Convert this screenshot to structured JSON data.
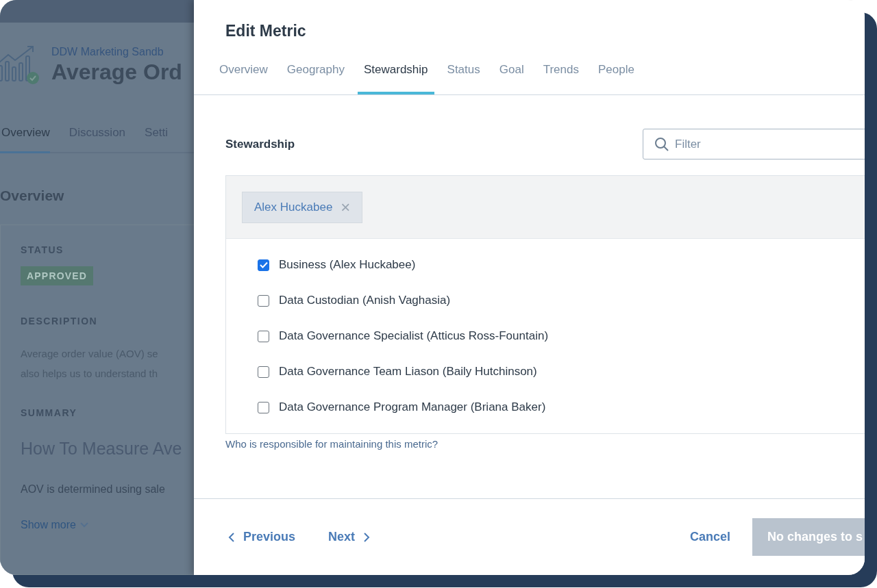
{
  "background_page": {
    "workspace": "DDW Marketing Sandb",
    "title": "Average Ord",
    "tabs": [
      {
        "label": "Overview",
        "selected": true
      },
      {
        "label": "Discussion",
        "selected": false
      },
      {
        "label": "Setti",
        "selected": false
      }
    ],
    "section_title": "Overview",
    "status_label": "STATUS",
    "status_badge": "APPROVED",
    "description_label": "DESCRIPTION",
    "description_lines": [
      "Average order value (AOV) se",
      "also helps us to understand th"
    ],
    "summary_label": "SUMMARY",
    "summary_title": "How To Measure Ave",
    "summary_text": "AOV is determined using sale",
    "show_more": "Show more"
  },
  "dialog": {
    "title": "Edit Metric",
    "tabs": [
      {
        "label": "Overview",
        "selected": false
      },
      {
        "label": "Geography",
        "selected": false
      },
      {
        "label": "Stewardship",
        "selected": true
      },
      {
        "label": "Status",
        "selected": false
      },
      {
        "label": "Goal",
        "selected": false
      },
      {
        "label": "Trends",
        "selected": false
      },
      {
        "label": "People",
        "selected": false
      }
    ],
    "section_label": "Stewardship",
    "filter": {
      "placeholder": "Filter"
    },
    "chips": [
      {
        "label": "Alex Huckabee",
        "remove": "×"
      }
    ],
    "options": [
      {
        "label": "Business (Alex Huckabee)",
        "checked": true
      },
      {
        "label": "Data Custodian (Anish Vaghasia)",
        "checked": false
      },
      {
        "label": "Data Governance Specialist (Atticus Ross-Fountain)",
        "checked": false
      },
      {
        "label": "Data Governance Team Liason (Baily Hutchinson)",
        "checked": false
      },
      {
        "label": "Data Governance Program Manager (Briana Baker)",
        "checked": false
      }
    ],
    "help_text": "Who is responsible for maintaining this metric?",
    "footer": {
      "previous": "Previous",
      "next": "Next",
      "cancel": "Cancel",
      "save": {
        "label": "No changes to s",
        "disabled": true
      }
    }
  }
}
